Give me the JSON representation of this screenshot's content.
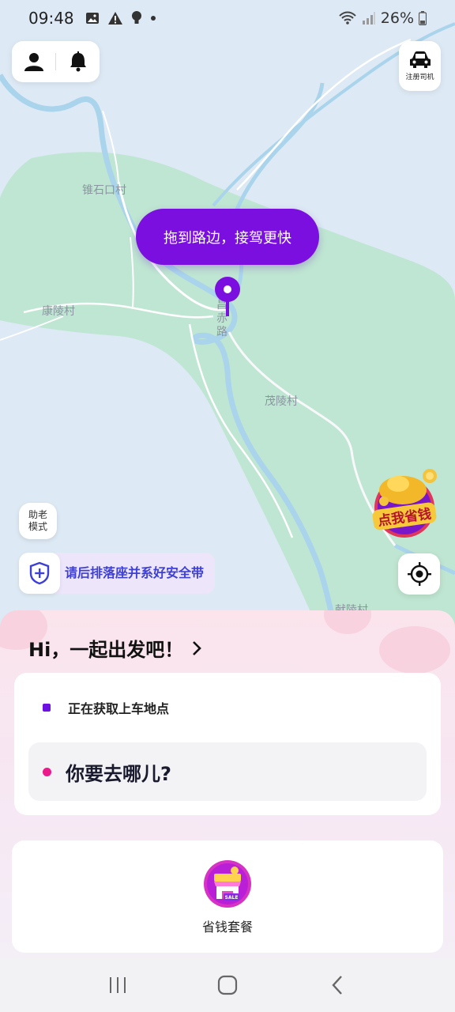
{
  "status_bar": {
    "time": "09:48",
    "battery": "26%"
  },
  "map": {
    "labels": {
      "village_1": "锥石口村",
      "village_2": "康陵村",
      "village_3": "茂陵村",
      "village_4": "献陵村",
      "road": "昌赤路"
    }
  },
  "top": {
    "profile_icon": "user-icon",
    "notification_icon": "bell-icon",
    "driver_register_label": "注册司机"
  },
  "map_overlay": {
    "bubble_text": "拖到路边，接驾更快",
    "promo_text": "点我省钱",
    "elderly_mode_line1": "助老",
    "elderly_mode_line2": "模式",
    "safety_tip": "请后排落座并系好安全带"
  },
  "sheet": {
    "greeting": "Hi，一起出发吧！",
    "pickup_text": "正在获取上车地点",
    "destination_placeholder": "你要去哪儿?",
    "service_label": "省钱套餐",
    "service_badge": "SALE"
  },
  "colors": {
    "brand_purple": "#7b0fe0",
    "pickup_dot": "#6d10e2",
    "destination_dot": "#ea1a8b",
    "safety_text": "#3d3fd6",
    "map_green": "#bfe6d2",
    "map_water": "#a9d4ec"
  }
}
